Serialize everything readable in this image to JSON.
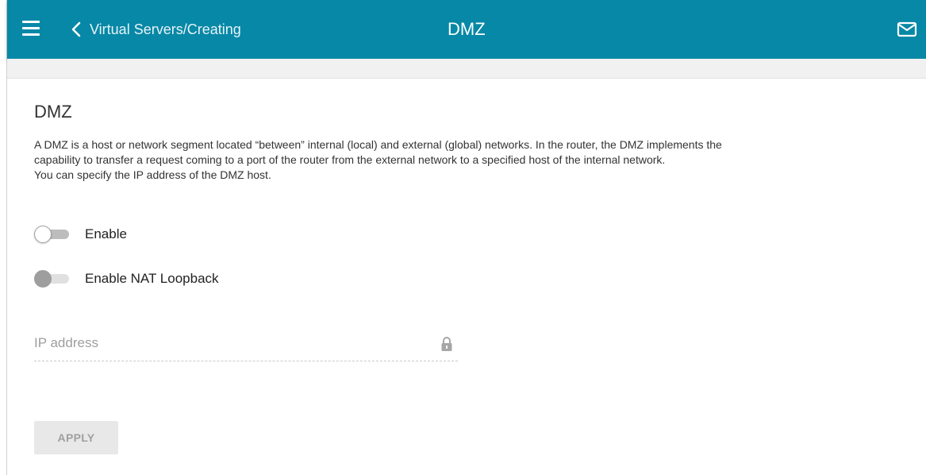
{
  "header": {
    "back_label": "Virtual Servers/Creating",
    "title": "DMZ",
    "icons": [
      "menu-icon",
      "chevron-left-icon",
      "mail-icon"
    ],
    "background_color": "#0788a6"
  },
  "main": {
    "heading": "DMZ",
    "description": [
      "A DMZ is a host or network segment located “between” internal (local) and external (global) networks. In the router, the DMZ implements the",
      "capability to transfer a request coming to a port of the router from the external network to a specified host of the internal network.",
      "You can specify the IP address of the DMZ host."
    ],
    "toggles": [
      {
        "label": "Enable",
        "state": "off",
        "enabled": true
      },
      {
        "label": "Enable NAT Loopback",
        "state": "off",
        "enabled": false
      }
    ],
    "ip_field": {
      "placeholder": "IP address",
      "value": "",
      "locked": true,
      "icon": "lock-icon"
    },
    "apply_button": {
      "label": "APPLY",
      "enabled": false
    }
  }
}
